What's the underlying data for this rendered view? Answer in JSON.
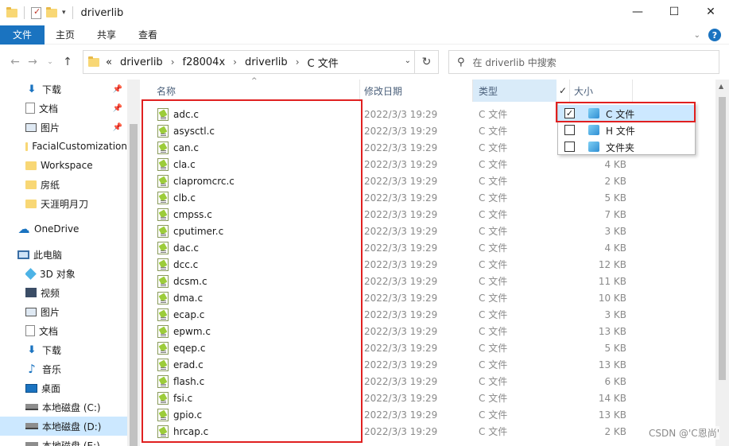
{
  "window": {
    "title": "driverlib",
    "controls": {
      "minimize": "—",
      "maximize": "☐",
      "close": "✕"
    }
  },
  "ribbon": {
    "file": "文件",
    "tabs": [
      "主页",
      "共享",
      "查看"
    ]
  },
  "address": {
    "overflow": "«",
    "crumbs": [
      "driverlib",
      "f28004x",
      "driverlib",
      "C 文件"
    ]
  },
  "search": {
    "placeholder": "在 driverlib 中搜索"
  },
  "sidebar": {
    "items": [
      {
        "label": "下载",
        "icon": "download-icon",
        "pinned": true
      },
      {
        "label": "文档",
        "icon": "document-icon",
        "pinned": true
      },
      {
        "label": "图片",
        "icon": "pictures-icon",
        "pinned": true
      },
      {
        "label": "FacialCustomization",
        "icon": "folder-icon",
        "pinned": false
      },
      {
        "label": "Workspace",
        "icon": "folder-icon",
        "pinned": false
      },
      {
        "label": "房纸",
        "icon": "folder-icon",
        "pinned": false
      },
      {
        "label": "天涯明月刀",
        "icon": "folder-icon",
        "pinned": false
      },
      {
        "label": "OneDrive",
        "icon": "onedrive-icon",
        "pinned": false
      },
      {
        "label": "此电脑",
        "icon": "computer-icon",
        "pinned": false
      },
      {
        "label": "3D 对象",
        "icon": "3d-objects-icon",
        "pinned": false
      },
      {
        "label": "视频",
        "icon": "video-icon",
        "pinned": false
      },
      {
        "label": "图片",
        "icon": "pictures-icon",
        "pinned": false
      },
      {
        "label": "文档",
        "icon": "document-icon",
        "pinned": false
      },
      {
        "label": "下载",
        "icon": "download-icon",
        "pinned": false
      },
      {
        "label": "音乐",
        "icon": "music-icon",
        "pinned": false
      },
      {
        "label": "桌面",
        "icon": "desktop-icon",
        "pinned": false
      },
      {
        "label": "本地磁盘 (C:)",
        "icon": "drive-icon",
        "pinned": false
      },
      {
        "label": "本地磁盘 (D:)",
        "icon": "drive-icon",
        "pinned": false
      },
      {
        "label": "本地磁盘 (E:)",
        "icon": "drive-icon",
        "pinned": false
      }
    ]
  },
  "columns": {
    "name": "名称",
    "date": "修改日期",
    "type": "类型",
    "size": "大小"
  },
  "files": [
    {
      "name": "adc.c",
      "date": "2022/3/3 19:29",
      "type": "C 文件",
      "size": ""
    },
    {
      "name": "asysctl.c",
      "date": "2022/3/3 19:29",
      "type": "C 文件",
      "size": ""
    },
    {
      "name": "can.c",
      "date": "2022/3/3 19:29",
      "type": "C 文件",
      "size": ""
    },
    {
      "name": "cla.c",
      "date": "2022/3/3 19:29",
      "type": "C 文件",
      "size": "4 KB"
    },
    {
      "name": "clapromcrc.c",
      "date": "2022/3/3 19:29",
      "type": "C 文件",
      "size": "2 KB"
    },
    {
      "name": "clb.c",
      "date": "2022/3/3 19:29",
      "type": "C 文件",
      "size": "5 KB"
    },
    {
      "name": "cmpss.c",
      "date": "2022/3/3 19:29",
      "type": "C 文件",
      "size": "7 KB"
    },
    {
      "name": "cputimer.c",
      "date": "2022/3/3 19:29",
      "type": "C 文件",
      "size": "3 KB"
    },
    {
      "name": "dac.c",
      "date": "2022/3/3 19:29",
      "type": "C 文件",
      "size": "4 KB"
    },
    {
      "name": "dcc.c",
      "date": "2022/3/3 19:29",
      "type": "C 文件",
      "size": "12 KB"
    },
    {
      "name": "dcsm.c",
      "date": "2022/3/3 19:29",
      "type": "C 文件",
      "size": "11 KB"
    },
    {
      "name": "dma.c",
      "date": "2022/3/3 19:29",
      "type": "C 文件",
      "size": "10 KB"
    },
    {
      "name": "ecap.c",
      "date": "2022/3/3 19:29",
      "type": "C 文件",
      "size": "3 KB"
    },
    {
      "name": "epwm.c",
      "date": "2022/3/3 19:29",
      "type": "C 文件",
      "size": "13 KB"
    },
    {
      "name": "eqep.c",
      "date": "2022/3/3 19:29",
      "type": "C 文件",
      "size": "5 KB"
    },
    {
      "name": "erad.c",
      "date": "2022/3/3 19:29",
      "type": "C 文件",
      "size": "13 KB"
    },
    {
      "name": "flash.c",
      "date": "2022/3/3 19:29",
      "type": "C 文件",
      "size": "6 KB"
    },
    {
      "name": "fsi.c",
      "date": "2022/3/3 19:29",
      "type": "C 文件",
      "size": "14 KB"
    },
    {
      "name": "gpio.c",
      "date": "2022/3/3 19:29",
      "type": "C 文件",
      "size": "13 KB"
    },
    {
      "name": "hrcap.c",
      "date": "2022/3/3 19:29",
      "type": "C 文件",
      "size": "2 KB"
    }
  ],
  "filter_popup": {
    "items": [
      {
        "label": "C 文件",
        "checked": true,
        "mark": "✓"
      },
      {
        "label": "H 文件",
        "checked": false,
        "mark": ""
      },
      {
        "label": "文件夹",
        "checked": false,
        "mark": ""
      }
    ]
  },
  "watermark": "CSDN @'C恩尚'",
  "colors": {
    "accent": "#1a73c0",
    "highlight": "#cce8ff",
    "annotation_red": "#e02020"
  }
}
